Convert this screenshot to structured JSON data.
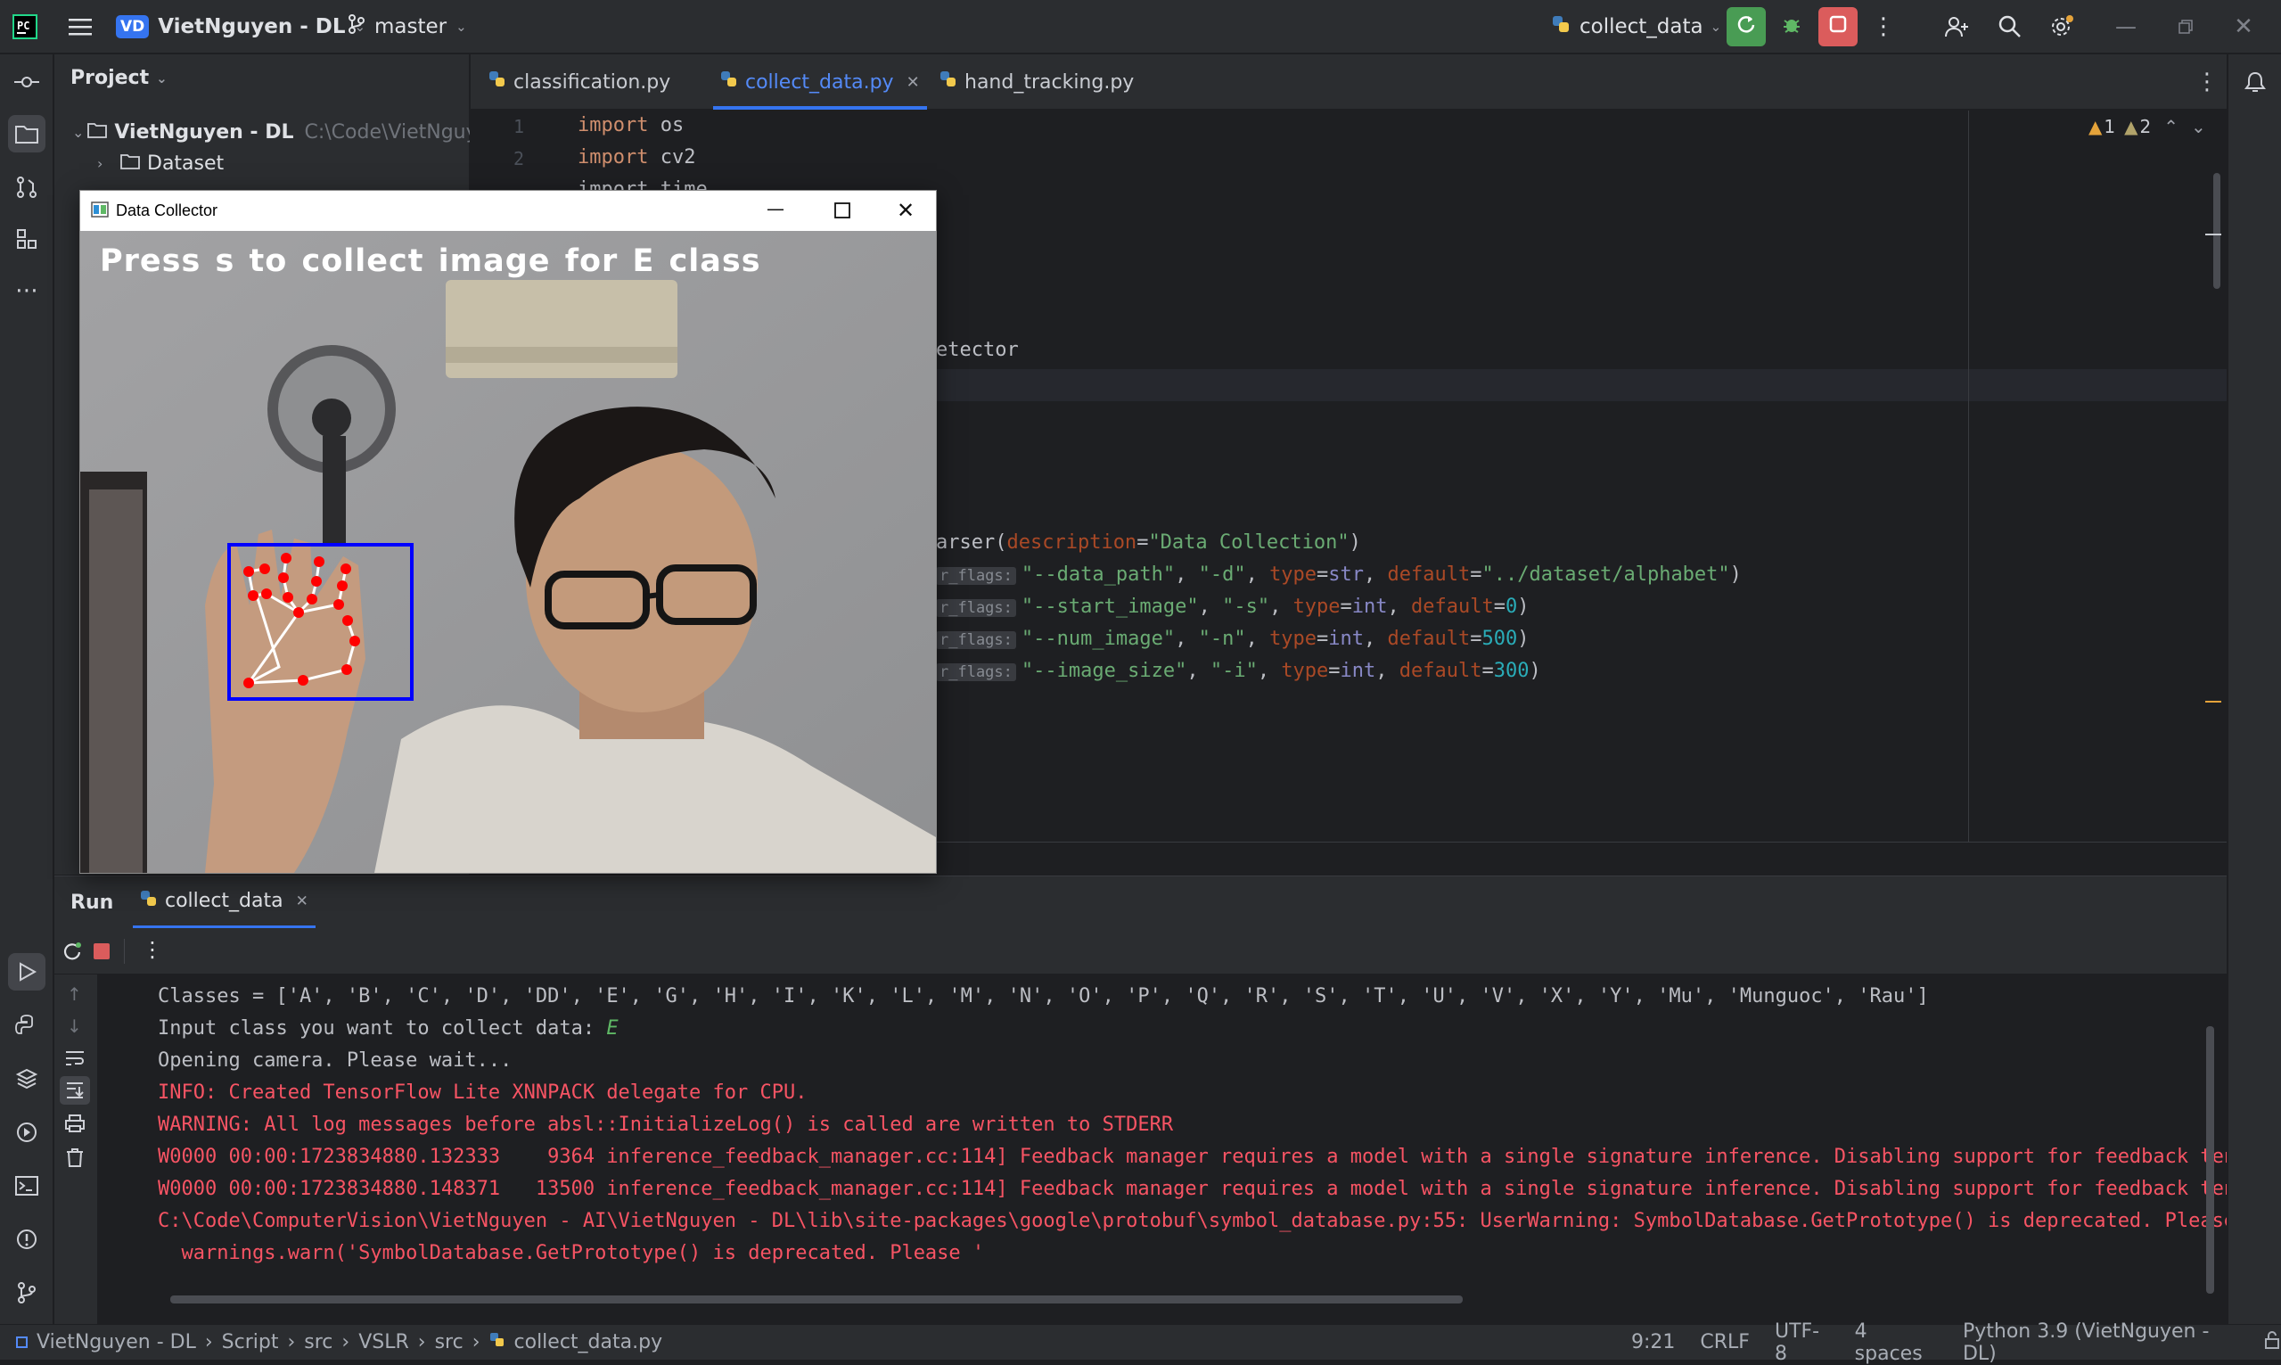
{
  "titlebar": {
    "project_badge": "VD",
    "project_name": "VietNguyen - DL",
    "branch": "master",
    "run_config": "collect_data"
  },
  "project_panel": {
    "title": "Project",
    "root_name": "VietNguyen - DL",
    "root_path": "C:\\Code\\VietNguyen",
    "items": [
      {
        "label": "Dataset"
      }
    ]
  },
  "tabs": [
    {
      "label": "classification.py"
    },
    {
      "label": "collect_data.py"
    },
    {
      "label": "hand_tracking.py"
    }
  ],
  "editor": {
    "warnings": "1",
    "weak_warnings": "2",
    "line_numbers": [
      "1",
      "2"
    ],
    "line1_kw": "import",
    "line1_mod": " os",
    "line2_kw": "import",
    "line2_mod": " cv2",
    "line3_partial": "import time",
    "frag_detector": "etector",
    "frag_parser_a": "arser(",
    "frag_parser_b": "description",
    "frag_parser_c": "=",
    "frag_parser_d": "\"Data Collection\"",
    "frag_parser_e": ")",
    "hint_label": "r_flags:",
    "args": [
      {
        "name": "\"--data_path\"",
        "short": "\"-d\"",
        "type": "str",
        "default": "\"../dataset/alphabet\""
      },
      {
        "name": "\"--start_image\"",
        "short": "\"-s\"",
        "type": "int",
        "default": "0"
      },
      {
        "name": "\"--num_image\"",
        "short": "\"-n\"",
        "type": "int",
        "default": "500"
      },
      {
        "name": "\"--image_size\"",
        "short": "\"-i\"",
        "type": "int",
        "default": "300"
      }
    ],
    "kw_type": "type",
    "kw_default": "default"
  },
  "data_collector": {
    "window_title": "Data Collector",
    "overlay_text": "Press s to collect image for E class"
  },
  "run_panel": {
    "run_label": "Run",
    "tab_label": "collect_data",
    "lines": [
      {
        "text": "Classes = ['A', 'B', 'C', 'D', 'DD', 'E', 'G', 'H', 'I', 'K', 'L', 'M', 'N', 'O', 'P', 'Q', 'R', 'S', 'T', 'U', 'V', 'X', 'Y', 'Mu', 'Munguoc', 'Rau']",
        "kind": "out"
      },
      {
        "text": "Input class you want to collect data: ",
        "input": "E",
        "kind": "out"
      },
      {
        "text": "Opening camera. Please wait...",
        "kind": "out"
      },
      {
        "text": "INFO: Created TensorFlow Lite XNNPACK delegate for CPU.",
        "kind": "err"
      },
      {
        "text": "WARNING: All log messages before absl::InitializeLog() is called are written to STDERR",
        "kind": "err"
      },
      {
        "text": "W0000 00:00:1723834880.132333    9364 inference_feedback_manager.cc:114] Feedback manager requires a model with a single signature inference. Disabling support for feedback tensors.",
        "kind": "err"
      },
      {
        "text": "W0000 00:00:1723834880.148371   13500 inference_feedback_manager.cc:114] Feedback manager requires a model with a single signature inference. Disabling support for feedback tensors.",
        "kind": "err"
      },
      {
        "text": "C:\\Code\\ComputerVision\\VietNguyen - AI\\VietNguyen - DL\\lib\\site-packages\\google\\protobuf\\symbol_database.py:55: UserWarning: SymbolDatabase.GetPrototype() is deprecated. Please use m",
        "kind": "err"
      },
      {
        "text": "  warnings.warn('SymbolDatabase.GetPrototype() is deprecated. Please '",
        "kind": "err"
      }
    ]
  },
  "statusbar": {
    "breadcrumbs": [
      "VietNguyen - DL",
      "Script",
      "src",
      "VSLR",
      "src",
      "collect_data.py"
    ],
    "position": "9:21",
    "line_sep": "CRLF",
    "encoding": "UTF-8",
    "indent": "4 spaces",
    "interpreter": "Python 3.9 (VietNguyen - DL)"
  },
  "colors": {
    "accent": "#3574f0",
    "run_green": "#499c54",
    "stop_red": "#db5c5c",
    "error_text": "#f75464"
  }
}
